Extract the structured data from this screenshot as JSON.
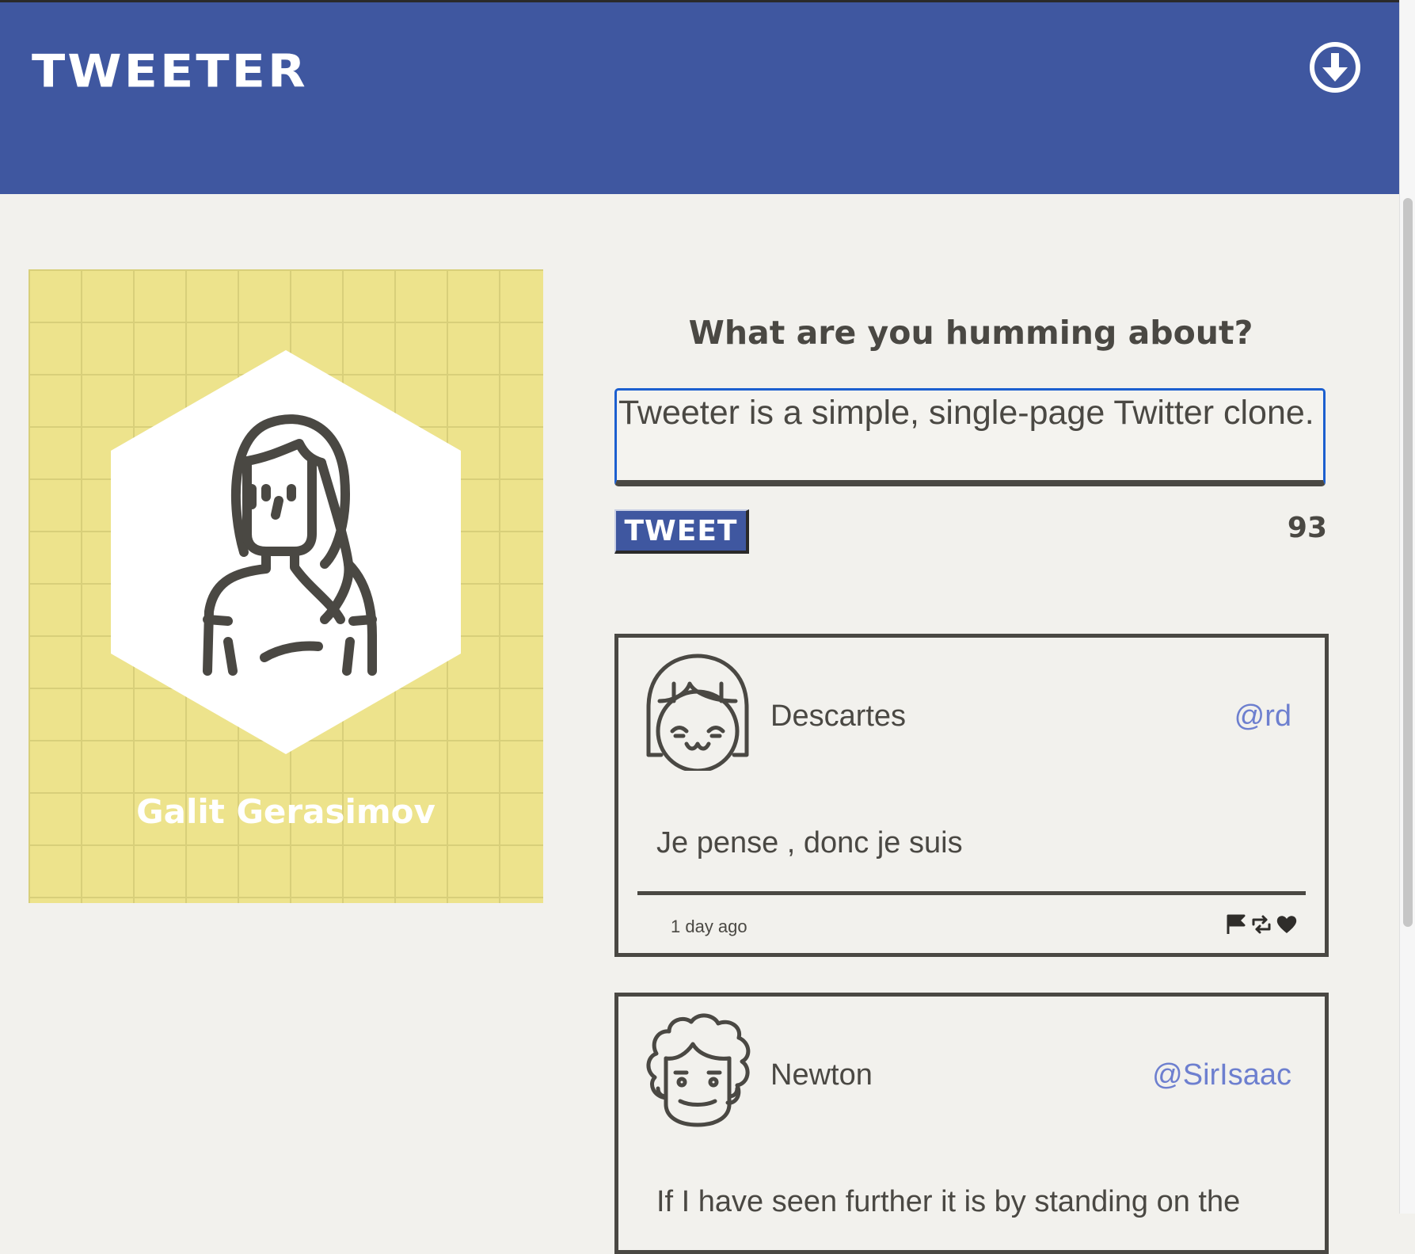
{
  "header": {
    "brand": "TWEETER",
    "compose_icon": "arrow-down-circle-icon",
    "color": "#3f57a0"
  },
  "profile": {
    "name": "Galit Gerasimov",
    "background_color": "#ede38c",
    "avatar_icon": "woman-avatar-icon"
  },
  "compose": {
    "heading": "What are you humming about?",
    "text": "Tweeter is a simple, single-page Twitter clone.",
    "button_label": "TWEET",
    "counter": "93"
  },
  "tweets": [
    {
      "author": "Descartes",
      "handle": "@rd",
      "text": "Je pense , donc je suis",
      "time": "1 day ago",
      "avatar_icon": "girl-avatar-icon",
      "actions": [
        "flag-icon",
        "retweet-icon",
        "heart-icon"
      ]
    },
    {
      "author": "Newton",
      "handle": "@SirIsaac",
      "text": "If I have seen further it is by standing on the",
      "avatar_icon": "curly-hair-avatar-icon"
    }
  ],
  "colors": {
    "accent": "#3f57a0",
    "background": "#f2f1ed",
    "text": "#4a4843",
    "handle": "#6d7fcf",
    "focus": "#1c5fcf"
  }
}
